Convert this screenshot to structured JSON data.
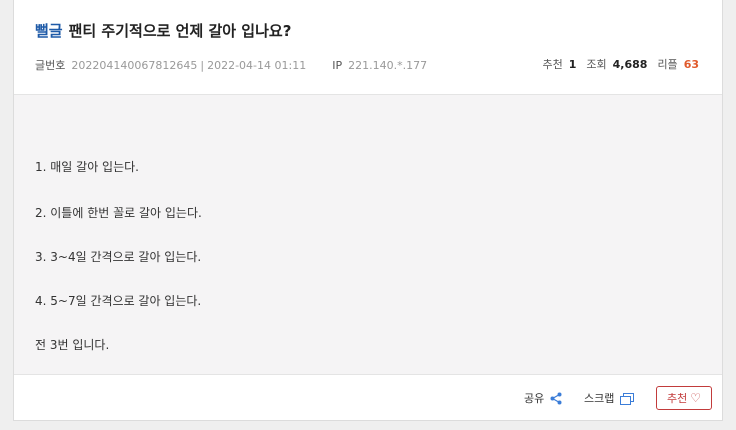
{
  "post": {
    "category": "뻘글",
    "title": "팬티 주기적으로 언제 갈아 입나요?",
    "meta": {
      "number_label": "글번호",
      "number": "20220414006781264​5",
      "date": "2022-04-14 01:11",
      "ip_label": "IP",
      "ip": "221.140.*.177"
    },
    "stats": {
      "recommend_label": "추천",
      "recommend": "1",
      "views_label": "조회",
      "views": "4,688",
      "comments_label": "리플",
      "comments": "63"
    },
    "content": [
      "1. 매일 갈아 입는다.",
      "2. 이틀에 한번 꼴로 갈아 입는다.",
      "3. 3~4일 간격으로 갈아 입는다.",
      "4. 5~7일 간격으로 갈아 입는다.",
      "전 3번 입니다."
    ]
  },
  "footer": {
    "share_label": "공유",
    "scrap_label": "스크랩",
    "recommend_label": "추천",
    "heart": "♡"
  },
  "colors": {
    "category": "#1f5ba8",
    "comments": "#e05a2b",
    "recommend": "#c23b3b",
    "content_bg": "#f5f4f5"
  }
}
